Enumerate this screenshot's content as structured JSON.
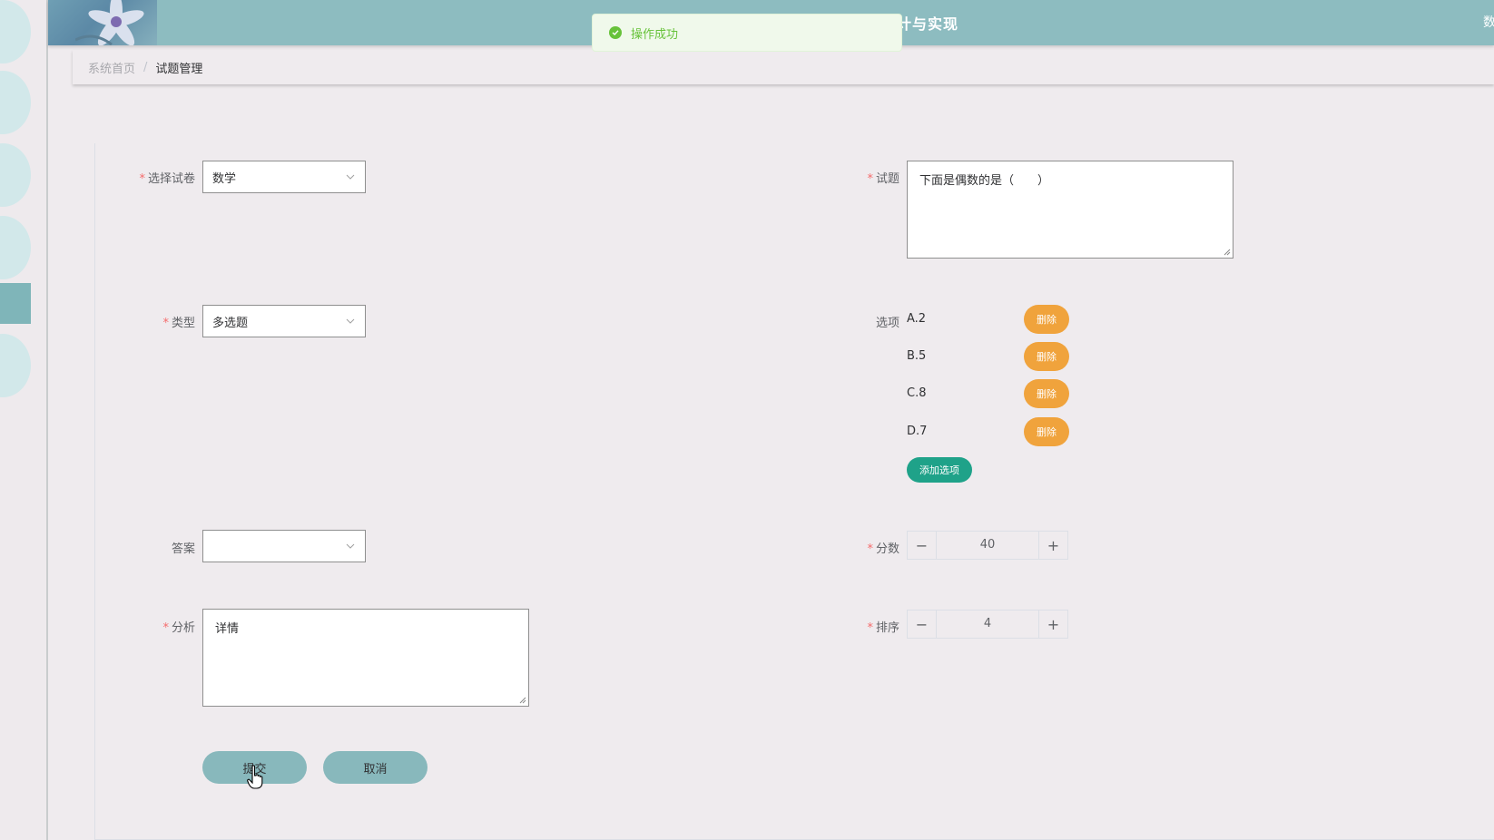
{
  "header": {
    "title": "计与实现",
    "user_text": "数"
  },
  "toast": {
    "message": "操作成功",
    "icon": "check-circle-icon",
    "color": "#67c23a"
  },
  "breadcrumb": {
    "home": "系统首页",
    "separator": "/",
    "current": "试题管理"
  },
  "form": {
    "paper": {
      "label": "选择试卷",
      "required": true,
      "value": "数学"
    },
    "type": {
      "label": "类型",
      "required": true,
      "value": "多选题"
    },
    "answer": {
      "label": "答案",
      "required": false,
      "value": ""
    },
    "analysis": {
      "label": "分析",
      "required": true,
      "value": "详情"
    },
    "question": {
      "label": "试题",
      "required": true,
      "value": "下面是偶数的是（　　）"
    },
    "options": {
      "label": "选项",
      "items": [
        {
          "text": "A.2",
          "delete_label": "删除"
        },
        {
          "text": "B.5",
          "delete_label": "删除"
        },
        {
          "text": "C.8",
          "delete_label": "删除"
        },
        {
          "text": "D.7",
          "delete_label": "删除"
        }
      ],
      "add_label": "添加选项"
    },
    "score": {
      "label": "分数",
      "required": true,
      "value": "40"
    },
    "order": {
      "label": "排序",
      "required": true,
      "value": "4"
    }
  },
  "buttons": {
    "submit": "提交",
    "cancel": "取消"
  },
  "colors": {
    "header": "#8dbcc0",
    "delete": "#f0a33c",
    "add": "#1fa289",
    "action": "#88b8bc",
    "required": "#f56c6c"
  }
}
